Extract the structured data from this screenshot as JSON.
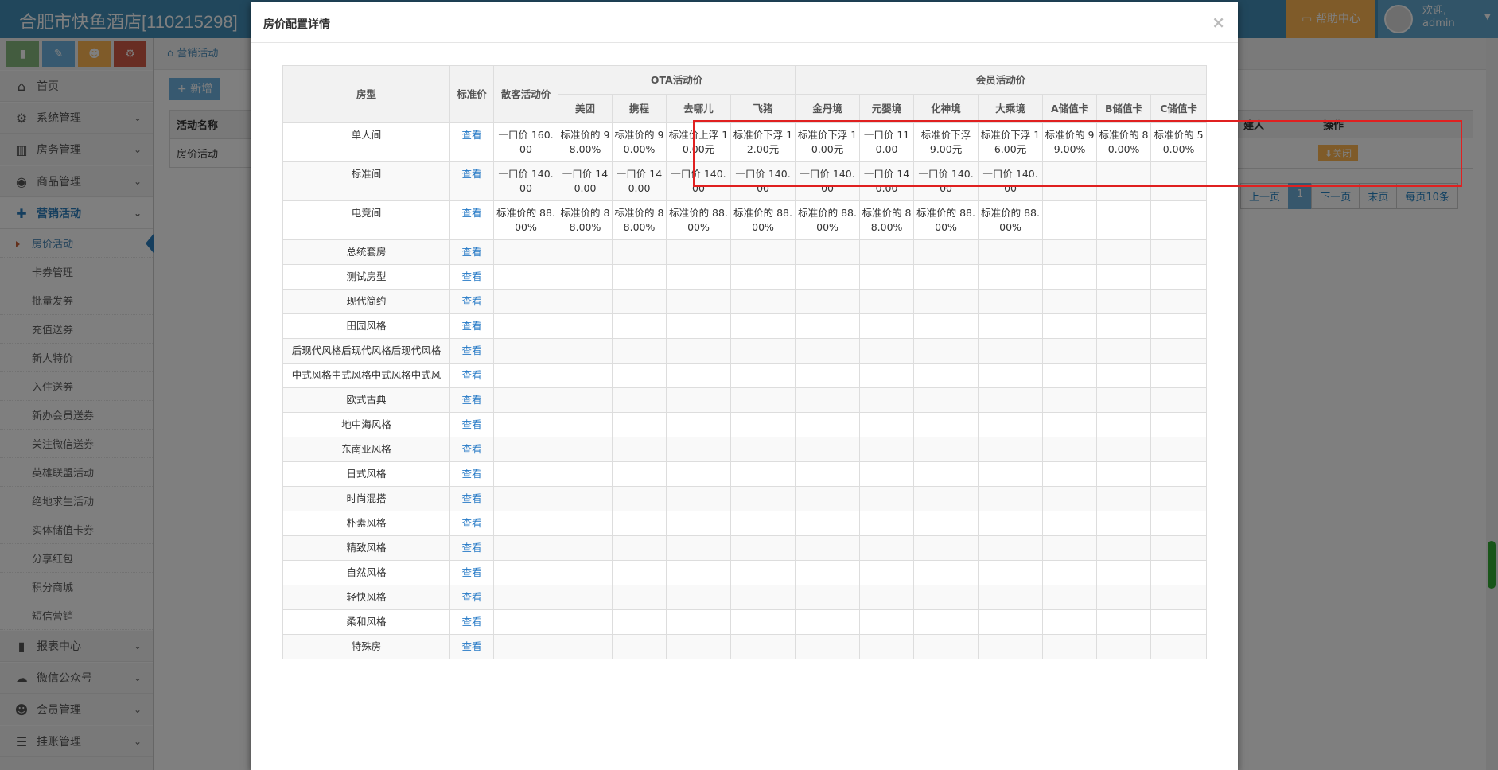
{
  "app": {
    "brand": "合肥市快鱼酒店[110215298]",
    "help": "帮助中心",
    "welcome": "欢迎,",
    "username": "admin"
  },
  "sidebar": {
    "items": [
      {
        "label": "首页",
        "icon": "home-icon"
      },
      {
        "label": "系统管理",
        "icon": "gear-icon"
      },
      {
        "label": "房务管理",
        "icon": "bank-icon"
      },
      {
        "label": "商品管理",
        "icon": "database-icon"
      },
      {
        "label": "营销活动",
        "icon": "gift-icon"
      }
    ],
    "sub_items": [
      "房价活动",
      "卡券管理",
      "批量发券",
      "充值送券",
      "新人特价",
      "入住送券",
      "新办会员送券",
      "关注微信送券",
      "英雄联盟活动",
      "绝地求生活动",
      "实体储值卡券",
      "分享红包",
      "积分商城",
      "短信营销"
    ],
    "bottom_items": [
      {
        "label": "报表中心",
        "icon": "bar-chart-icon"
      },
      {
        "label": "微信公众号",
        "icon": "cloud-icon"
      },
      {
        "label": "会员管理",
        "icon": "users-icon"
      },
      {
        "label": "挂账管理",
        "icon": "list-icon"
      }
    ]
  },
  "background": {
    "breadcrumb": "营销活动",
    "add_label": "新增",
    "col_name": "活动名称",
    "row_name": "房价活动",
    "col_person": "建人",
    "col_op": "操作",
    "op_label": "关闭",
    "pager": [
      "上一页",
      "1",
      "下一页",
      "末页",
      "每页10条"
    ]
  },
  "modal": {
    "title": "房价配置详情",
    "close": "×",
    "headers": {
      "room_type": "房型",
      "std_price": "标准价",
      "walkin": "散客活动价",
      "ota_group": "OTA活动价",
      "member_group": "会员活动价",
      "ota": [
        "美团",
        "携程",
        "去哪儿",
        "飞猪"
      ],
      "member": [
        "金丹境",
        "元婴境",
        "化神境",
        "大乘境",
        "A储值卡",
        "B储值卡",
        "C储值卡"
      ]
    },
    "view_label": "查看",
    "rows": [
      {
        "name": "单人间",
        "cells": [
          "一口价 160.00",
          "标准价的 98.00%",
          "标准价的 90.00%",
          "标准价上浮 10.00元",
          "标准价下浮 12.00元",
          "标准价下浮 10.00元",
          "一口价 110.00",
          "标准价下浮 9.00元",
          "标准价下浮 16.00元",
          "标准价的 99.00%",
          "标准价的 80.00%",
          "标准价的 50.00%"
        ]
      },
      {
        "name": "标准间",
        "cells": [
          "一口价 140.00",
          "一口价 140.00",
          "一口价 140.00",
          "一口价 140.00",
          "一口价 140.00",
          "一口价 140.00",
          "一口价 140.00",
          "一口价 140.00",
          "一口价 140.00",
          "",
          "",
          ""
        ]
      },
      {
        "name": "电竞间",
        "cells": [
          "标准价的 88.00%",
          "标准价的 88.00%",
          "标准价的 88.00%",
          "标准价的 88.00%",
          "标准价的 88.00%",
          "标准价的 88.00%",
          "标准价的 88.00%",
          "标准价的 88.00%",
          "标准价的 88.00%",
          "",
          "",
          ""
        ]
      },
      {
        "name": "总统套房",
        "cells": []
      },
      {
        "name": "测试房型",
        "cells": []
      },
      {
        "name": "现代简约",
        "cells": []
      },
      {
        "name": "田园风格",
        "cells": []
      },
      {
        "name": "后现代风格后现代风格后现代风格",
        "cells": []
      },
      {
        "name": "中式风格中式风格中式风格中式风",
        "cells": []
      },
      {
        "name": "欧式古典",
        "cells": []
      },
      {
        "name": "地中海风格",
        "cells": []
      },
      {
        "name": "东南亚风格",
        "cells": []
      },
      {
        "name": "日式风格",
        "cells": []
      },
      {
        "name": "时尚混搭",
        "cells": []
      },
      {
        "name": "朴素风格",
        "cells": []
      },
      {
        "name": "精致风格",
        "cells": []
      },
      {
        "name": "自然风格",
        "cells": []
      },
      {
        "name": "轻快风格",
        "cells": []
      },
      {
        "name": "柔和风格",
        "cells": []
      },
      {
        "name": "特殊房",
        "cells": []
      }
    ]
  }
}
